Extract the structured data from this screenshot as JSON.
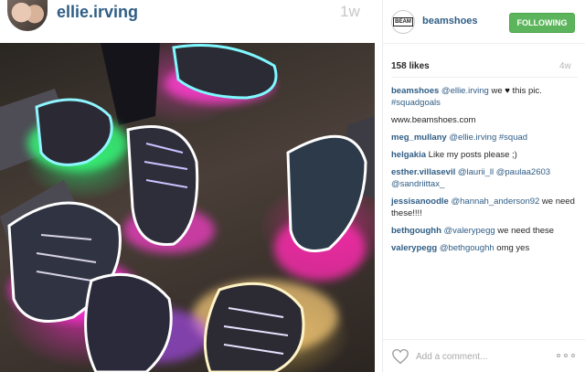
{
  "feed": {
    "username": "ellie.irving",
    "time": "1w"
  },
  "post": {
    "author": "beamshoes",
    "author_badge": "BEAM",
    "follow_label": "FOLLOWING",
    "likes": "158 likes",
    "time": "4w",
    "caption": {
      "user": "beamshoes",
      "mention": "@ellie.irving",
      "text_before": "we",
      "heart": "♥",
      "text_after": "this pic.",
      "hashtag": "#squadgoals"
    },
    "comments": [
      {
        "user": "",
        "parts": [
          {
            "text": "www.beamshoes.com",
            "type": "plain"
          }
        ]
      },
      {
        "user": "meg_mullany",
        "parts": [
          {
            "text": "@ellie.irving",
            "type": "mention"
          },
          {
            "text": " ",
            "type": "plain"
          },
          {
            "text": "#squad",
            "type": "hashtag"
          }
        ]
      },
      {
        "user": "helgakia",
        "parts": [
          {
            "text": "Like my posts please ;)",
            "type": "plain"
          }
        ]
      },
      {
        "user": "esther.villasevil",
        "parts": [
          {
            "text": "@laurii_ll",
            "type": "mention"
          },
          {
            "text": " ",
            "type": "plain"
          },
          {
            "text": "@paulaa2603",
            "type": "mention"
          },
          {
            "text": " ",
            "type": "plain"
          },
          {
            "text": "@sandriittax_",
            "type": "mention"
          }
        ]
      },
      {
        "user": "jessisanoodle",
        "parts": [
          {
            "text": "@hannah_anderson92",
            "type": "mention"
          },
          {
            "text": " we need these!!!!",
            "type": "plain"
          }
        ]
      },
      {
        "user": "bethgoughh",
        "parts": [
          {
            "text": "@valerypegg",
            "type": "mention"
          },
          {
            "text": " we need these",
            "type": "plain"
          }
        ]
      },
      {
        "user": "valerypegg",
        "parts": [
          {
            "text": "@bethgoughh",
            "type": "mention"
          },
          {
            "text": " omg yes",
            "type": "plain"
          }
        ]
      }
    ],
    "comment_placeholder": "Add a comment...",
    "icons": {
      "like": "heart-outline-icon",
      "more": "more-options-icon"
    }
  },
  "colors": {
    "link": "#2f5d85",
    "follow_button": "#5cb55c",
    "muted": "#b8b8b8"
  }
}
